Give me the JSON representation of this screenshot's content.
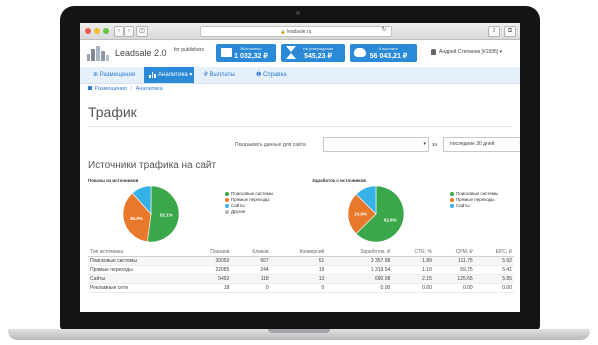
{
  "browser": {
    "url": "leadsale.ru",
    "back_label": "‹",
    "forward_label": "›",
    "sidebar_label": "◫",
    "reload_label": "↻",
    "share_label": "⇪",
    "tabs_label": "⧉",
    "dot_colors": [
      "#ee5a52",
      "#f5bd30",
      "#5fc43f"
    ]
  },
  "app": {
    "logo_name": "Leadsale 2.0",
    "logo_suffix": "for publishers",
    "user_label": "Андрей Степанов [#1995] ▾"
  },
  "stats": [
    {
      "label": "Выплачено",
      "value": "1 032,32 ₽",
      "icon": "briefcase-icon"
    },
    {
      "label": "На утверждении",
      "value": "545,23 ₽",
      "icon": "hourglass-icon"
    },
    {
      "label": "К выплате",
      "value": "56 043,21 ₽",
      "icon": "piggy-bank-icon"
    }
  ],
  "menu": {
    "placements": "⊕ Размещения",
    "analytics": "Аналитика ▾",
    "payouts": "₽ Выплаты",
    "help": "❶ Справка"
  },
  "breadcrumb": {
    "home": "Размещения",
    "separator": "/",
    "current": "Аналитика"
  },
  "page_title": "Трафик",
  "filters": {
    "site_label": "Показывать данные для сайта",
    "site_value": "",
    "period_label": "за",
    "period_value": "последние 30 дней"
  },
  "section_title": "Источники трафика на сайт",
  "colors": {
    "green": "#3aa84a",
    "orange": "#e8792b",
    "blue": "#37b2e6",
    "gray": "#b9b9b9",
    "accent": "#2a8ad8"
  },
  "chart_data": [
    {
      "type": "pie",
      "title": "Показы из источников",
      "slices": [
        {
          "label": "Поисковые системы",
          "value": 52.1,
          "text": "52.1%",
          "color": "#3aa84a"
        },
        {
          "label": "Прямые переходы",
          "value": 36.3,
          "text": "36.3%",
          "color": "#e8792b"
        },
        {
          "label": "Сайты",
          "value": 11.6,
          "text": "",
          "color": "#37b2e6"
        },
        {
          "label": "Другие",
          "value": 0,
          "text": "",
          "color": "#b9b9b9"
        }
      ],
      "legend_placement": "right"
    },
    {
      "type": "pie",
      "title": "Заработок с источников",
      "slices": [
        {
          "label": "Поисковые системы",
          "value": 62.6,
          "text": "62.6%",
          "color": "#3aa84a"
        },
        {
          "label": "Прямые переходы",
          "value": 24.9,
          "text": "24.9%",
          "color": "#e8792b"
        },
        {
          "label": "Сайты",
          "value": 12.5,
          "text": "",
          "color": "#37b2e6"
        }
      ],
      "legend_placement": "right"
    }
  ],
  "table": {
    "columns": [
      "Тип источника",
      "Показов",
      "Кликов",
      "Конверсий",
      "Заработок, ₽",
      "CTR, %",
      "CPM, ₽",
      "EPC, ₽"
    ],
    "rows": [
      [
        "Поисковые системы",
        "30050",
        "567",
        "51",
        "3 357.98",
        "1.89",
        "111.75",
        "5.92"
      ],
      [
        "Прямые переходы",
        "22085",
        "244",
        "19",
        "1 319.54",
        "1.10",
        "59.75",
        "5.41"
      ],
      [
        "Сайты",
        "5492",
        "118",
        "13",
        "690.08",
        "2.15",
        "125.65",
        "5.85"
      ],
      [
        "Рекламные сети",
        "18",
        "0",
        "0",
        "0.00",
        "0.00",
        "0.00",
        "0.00"
      ]
    ]
  }
}
